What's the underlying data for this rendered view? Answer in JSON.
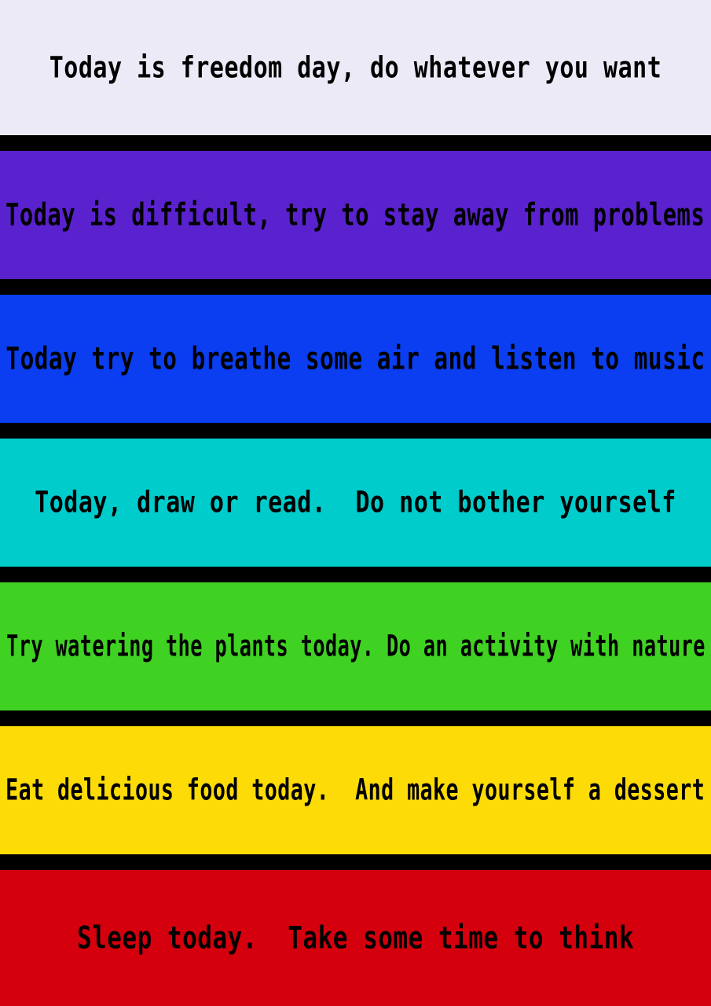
{
  "bands": [
    {
      "text": "Today is freedom day, do whatever you want",
      "color": "#ECEAF6"
    },
    {
      "text": "Today is difficult, try to stay away from problems",
      "color": "#5A22CE"
    },
    {
      "text": "Today try to breathe some air and listen to music",
      "color": "#0A3EF0"
    },
    {
      "text": "Today, draw or read.  Do not bother yourself",
      "color": "#00CCCC"
    },
    {
      "text": "Try watering the plants today. Do an activity with nature",
      "color": "#40D223"
    },
    {
      "text": "Eat delicious food today.  And make yourself a dessert",
      "color": "#FDDB07"
    },
    {
      "text": "Sleep today.  Take some time to think",
      "color": "#D5000D"
    }
  ],
  "divider_color": "#000000"
}
